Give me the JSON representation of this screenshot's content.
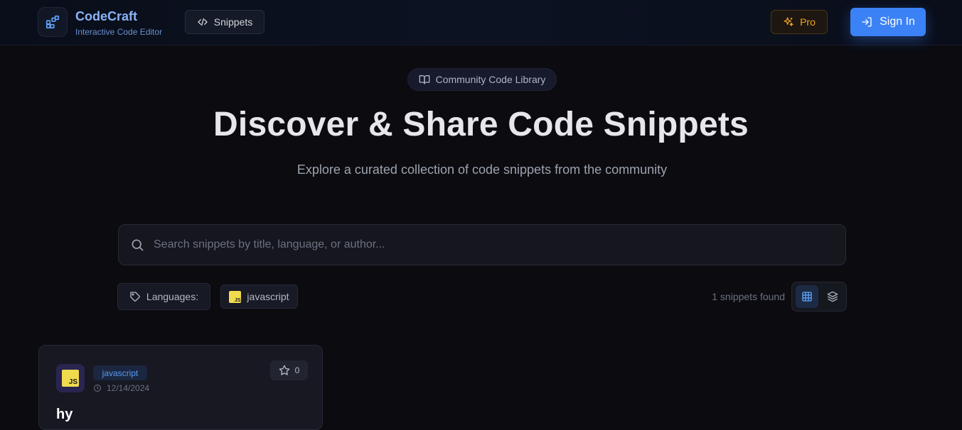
{
  "header": {
    "brand_title": "CodeCraft",
    "brand_subtitle": "Interactive Code Editor",
    "nav_snippets": "Snippets",
    "pro_label": "Pro",
    "signin_label": "Sign In"
  },
  "hero": {
    "pill_label": "Community Code Library",
    "title": "Discover & Share Code Snippets",
    "subtitle": "Explore a curated collection of code snippets from the community"
  },
  "search": {
    "placeholder": "Search snippets by title, language, or author...",
    "value": ""
  },
  "filters": {
    "languages_label": "Languages:",
    "languages": [
      {
        "name": "javascript",
        "icon": "js-logo-icon"
      }
    ],
    "result_count": "1 snippets found",
    "view_modes": [
      "grid-view",
      "list-view"
    ],
    "active_view": "grid-view"
  },
  "snippets": [
    {
      "language": "javascript",
      "date": "12/14/2024",
      "stars": "0",
      "title": "hy"
    }
  ],
  "colors": {
    "accent": "#3b82f6",
    "pro": "#f5a524",
    "background": "#0b0b10",
    "brand": "#8ab4f8"
  }
}
